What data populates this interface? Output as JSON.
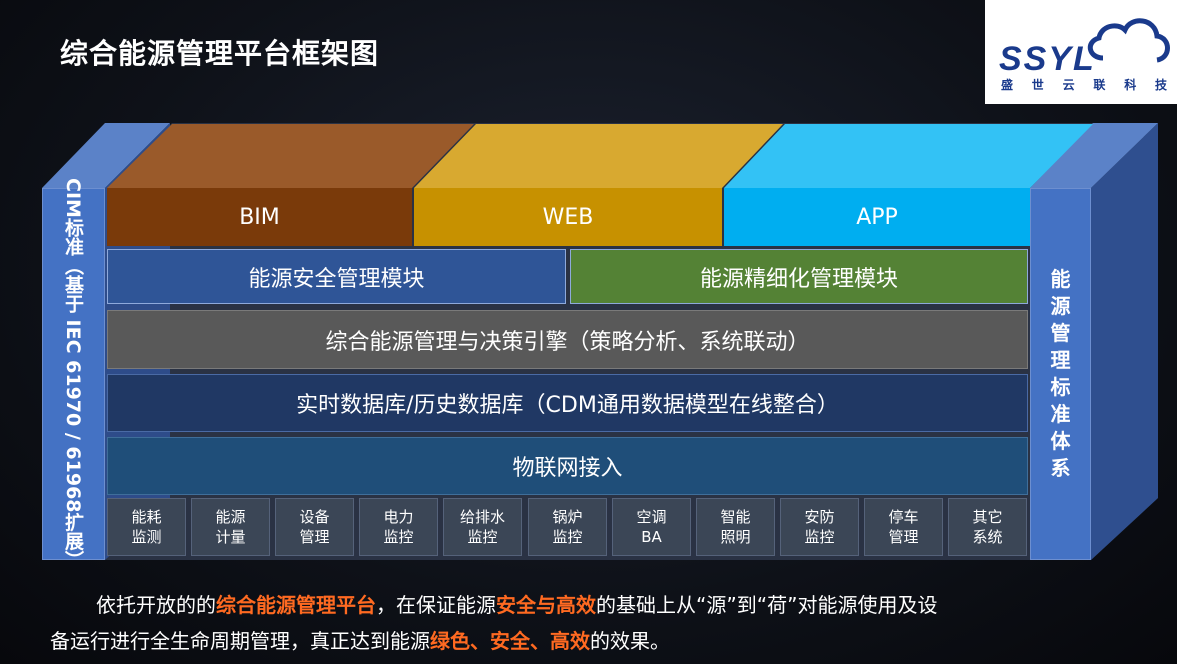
{
  "title": "综合能源管理平台框架图",
  "logo": {
    "text": "SSYL",
    "sub": [
      "盛",
      "世",
      "云",
      "联",
      "科",
      "技"
    ]
  },
  "top_blocks": [
    {
      "label": "BIM",
      "color": "#7a3a0a",
      "top_color": "#9a5a2a"
    },
    {
      "label": "WEB",
      "color": "#c79100",
      "top_color": "#d8a930"
    },
    {
      "label": "APP",
      "color": "#00aef0",
      "top_color": "#33c2f5"
    }
  ],
  "modules": {
    "left": "能源安全管理模块",
    "right": "能源精细化管理模块"
  },
  "layers": {
    "engine": "综合能源管理与决策引擎（策略分析、系统联动）",
    "database": "实时数据库/历史数据库（CDM通用数据模型在线整合）",
    "iot": "物联网接入"
  },
  "categories": [
    [
      "能耗",
      "监测"
    ],
    [
      "能源",
      "计量"
    ],
    [
      "设备",
      "管理"
    ],
    [
      "电力",
      "监控"
    ],
    [
      "给排水",
      "监控"
    ],
    [
      "锅炉",
      "监控"
    ],
    [
      "空调",
      "BA"
    ],
    [
      "智能",
      "照明"
    ],
    [
      "安防",
      "监控"
    ],
    [
      "停车",
      "管理"
    ],
    [
      "其它",
      "系统"
    ]
  ],
  "left_pillar": "CIM标准（基于 IEC 61970 / 61968扩展）",
  "right_pillar": [
    "能",
    "源",
    "管",
    "理",
    "标",
    "准",
    "体",
    "系"
  ],
  "description": {
    "line1": [
      {
        "text": "依托开放的的",
        "hl": false
      },
      {
        "text": "综合能源管理平台",
        "hl": true
      },
      {
        "text": "，在保证能源",
        "hl": false
      },
      {
        "text": "安全与高效",
        "hl": true
      },
      {
        "text": "的基础上从“源”到“荷”对能源使用及设",
        "hl": false
      }
    ],
    "line2": [
      {
        "text": "备运行进行全生命周期管理，真正达到能源",
        "hl": false
      },
      {
        "text": "绿色、安全、高效",
        "hl": true
      },
      {
        "text": "的效果。",
        "hl": false
      }
    ]
  },
  "colors": {
    "highlight": "#ff6a21",
    "pillar": "#4472c4",
    "module_left": "#2f5597",
    "module_right": "#548235",
    "engine": "#595959",
    "database": "#203864",
    "iot": "#1f4e79"
  }
}
